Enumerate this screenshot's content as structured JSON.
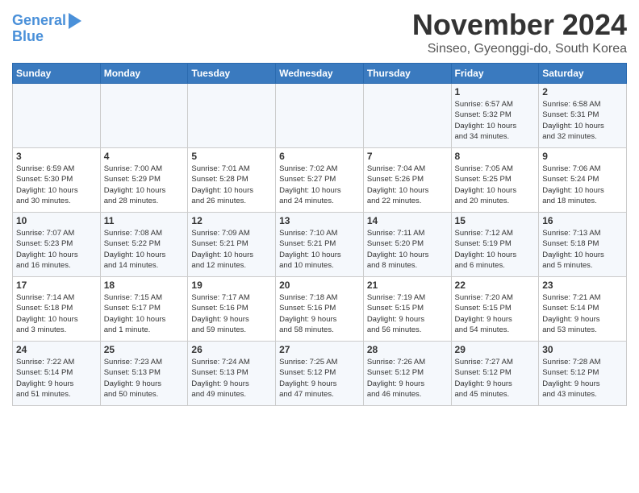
{
  "logo": {
    "line1": "General",
    "line2": "Blue"
  },
  "title": "November 2024",
  "subtitle": "Sinseo, Gyeonggi-do, South Korea",
  "days_of_week": [
    "Sunday",
    "Monday",
    "Tuesday",
    "Wednesday",
    "Thursday",
    "Friday",
    "Saturday"
  ],
  "weeks": [
    [
      {
        "day": "",
        "info": ""
      },
      {
        "day": "",
        "info": ""
      },
      {
        "day": "",
        "info": ""
      },
      {
        "day": "",
        "info": ""
      },
      {
        "day": "",
        "info": ""
      },
      {
        "day": "1",
        "info": "Sunrise: 6:57 AM\nSunset: 5:32 PM\nDaylight: 10 hours\nand 34 minutes."
      },
      {
        "day": "2",
        "info": "Sunrise: 6:58 AM\nSunset: 5:31 PM\nDaylight: 10 hours\nand 32 minutes."
      }
    ],
    [
      {
        "day": "3",
        "info": "Sunrise: 6:59 AM\nSunset: 5:30 PM\nDaylight: 10 hours\nand 30 minutes."
      },
      {
        "day": "4",
        "info": "Sunrise: 7:00 AM\nSunset: 5:29 PM\nDaylight: 10 hours\nand 28 minutes."
      },
      {
        "day": "5",
        "info": "Sunrise: 7:01 AM\nSunset: 5:28 PM\nDaylight: 10 hours\nand 26 minutes."
      },
      {
        "day": "6",
        "info": "Sunrise: 7:02 AM\nSunset: 5:27 PM\nDaylight: 10 hours\nand 24 minutes."
      },
      {
        "day": "7",
        "info": "Sunrise: 7:04 AM\nSunset: 5:26 PM\nDaylight: 10 hours\nand 22 minutes."
      },
      {
        "day": "8",
        "info": "Sunrise: 7:05 AM\nSunset: 5:25 PM\nDaylight: 10 hours\nand 20 minutes."
      },
      {
        "day": "9",
        "info": "Sunrise: 7:06 AM\nSunset: 5:24 PM\nDaylight: 10 hours\nand 18 minutes."
      }
    ],
    [
      {
        "day": "10",
        "info": "Sunrise: 7:07 AM\nSunset: 5:23 PM\nDaylight: 10 hours\nand 16 minutes."
      },
      {
        "day": "11",
        "info": "Sunrise: 7:08 AM\nSunset: 5:22 PM\nDaylight: 10 hours\nand 14 minutes."
      },
      {
        "day": "12",
        "info": "Sunrise: 7:09 AM\nSunset: 5:21 PM\nDaylight: 10 hours\nand 12 minutes."
      },
      {
        "day": "13",
        "info": "Sunrise: 7:10 AM\nSunset: 5:21 PM\nDaylight: 10 hours\nand 10 minutes."
      },
      {
        "day": "14",
        "info": "Sunrise: 7:11 AM\nSunset: 5:20 PM\nDaylight: 10 hours\nand 8 minutes."
      },
      {
        "day": "15",
        "info": "Sunrise: 7:12 AM\nSunset: 5:19 PM\nDaylight: 10 hours\nand 6 minutes."
      },
      {
        "day": "16",
        "info": "Sunrise: 7:13 AM\nSunset: 5:18 PM\nDaylight: 10 hours\nand 5 minutes."
      }
    ],
    [
      {
        "day": "17",
        "info": "Sunrise: 7:14 AM\nSunset: 5:18 PM\nDaylight: 10 hours\nand 3 minutes."
      },
      {
        "day": "18",
        "info": "Sunrise: 7:15 AM\nSunset: 5:17 PM\nDaylight: 10 hours\nand 1 minute."
      },
      {
        "day": "19",
        "info": "Sunrise: 7:17 AM\nSunset: 5:16 PM\nDaylight: 9 hours\nand 59 minutes."
      },
      {
        "day": "20",
        "info": "Sunrise: 7:18 AM\nSunset: 5:16 PM\nDaylight: 9 hours\nand 58 minutes."
      },
      {
        "day": "21",
        "info": "Sunrise: 7:19 AM\nSunset: 5:15 PM\nDaylight: 9 hours\nand 56 minutes."
      },
      {
        "day": "22",
        "info": "Sunrise: 7:20 AM\nSunset: 5:15 PM\nDaylight: 9 hours\nand 54 minutes."
      },
      {
        "day": "23",
        "info": "Sunrise: 7:21 AM\nSunset: 5:14 PM\nDaylight: 9 hours\nand 53 minutes."
      }
    ],
    [
      {
        "day": "24",
        "info": "Sunrise: 7:22 AM\nSunset: 5:14 PM\nDaylight: 9 hours\nand 51 minutes."
      },
      {
        "day": "25",
        "info": "Sunrise: 7:23 AM\nSunset: 5:13 PM\nDaylight: 9 hours\nand 50 minutes."
      },
      {
        "day": "26",
        "info": "Sunrise: 7:24 AM\nSunset: 5:13 PM\nDaylight: 9 hours\nand 49 minutes."
      },
      {
        "day": "27",
        "info": "Sunrise: 7:25 AM\nSunset: 5:12 PM\nDaylight: 9 hours\nand 47 minutes."
      },
      {
        "day": "28",
        "info": "Sunrise: 7:26 AM\nSunset: 5:12 PM\nDaylight: 9 hours\nand 46 minutes."
      },
      {
        "day": "29",
        "info": "Sunrise: 7:27 AM\nSunset: 5:12 PM\nDaylight: 9 hours\nand 45 minutes."
      },
      {
        "day": "30",
        "info": "Sunrise: 7:28 AM\nSunset: 5:12 PM\nDaylight: 9 hours\nand 43 minutes."
      }
    ]
  ]
}
